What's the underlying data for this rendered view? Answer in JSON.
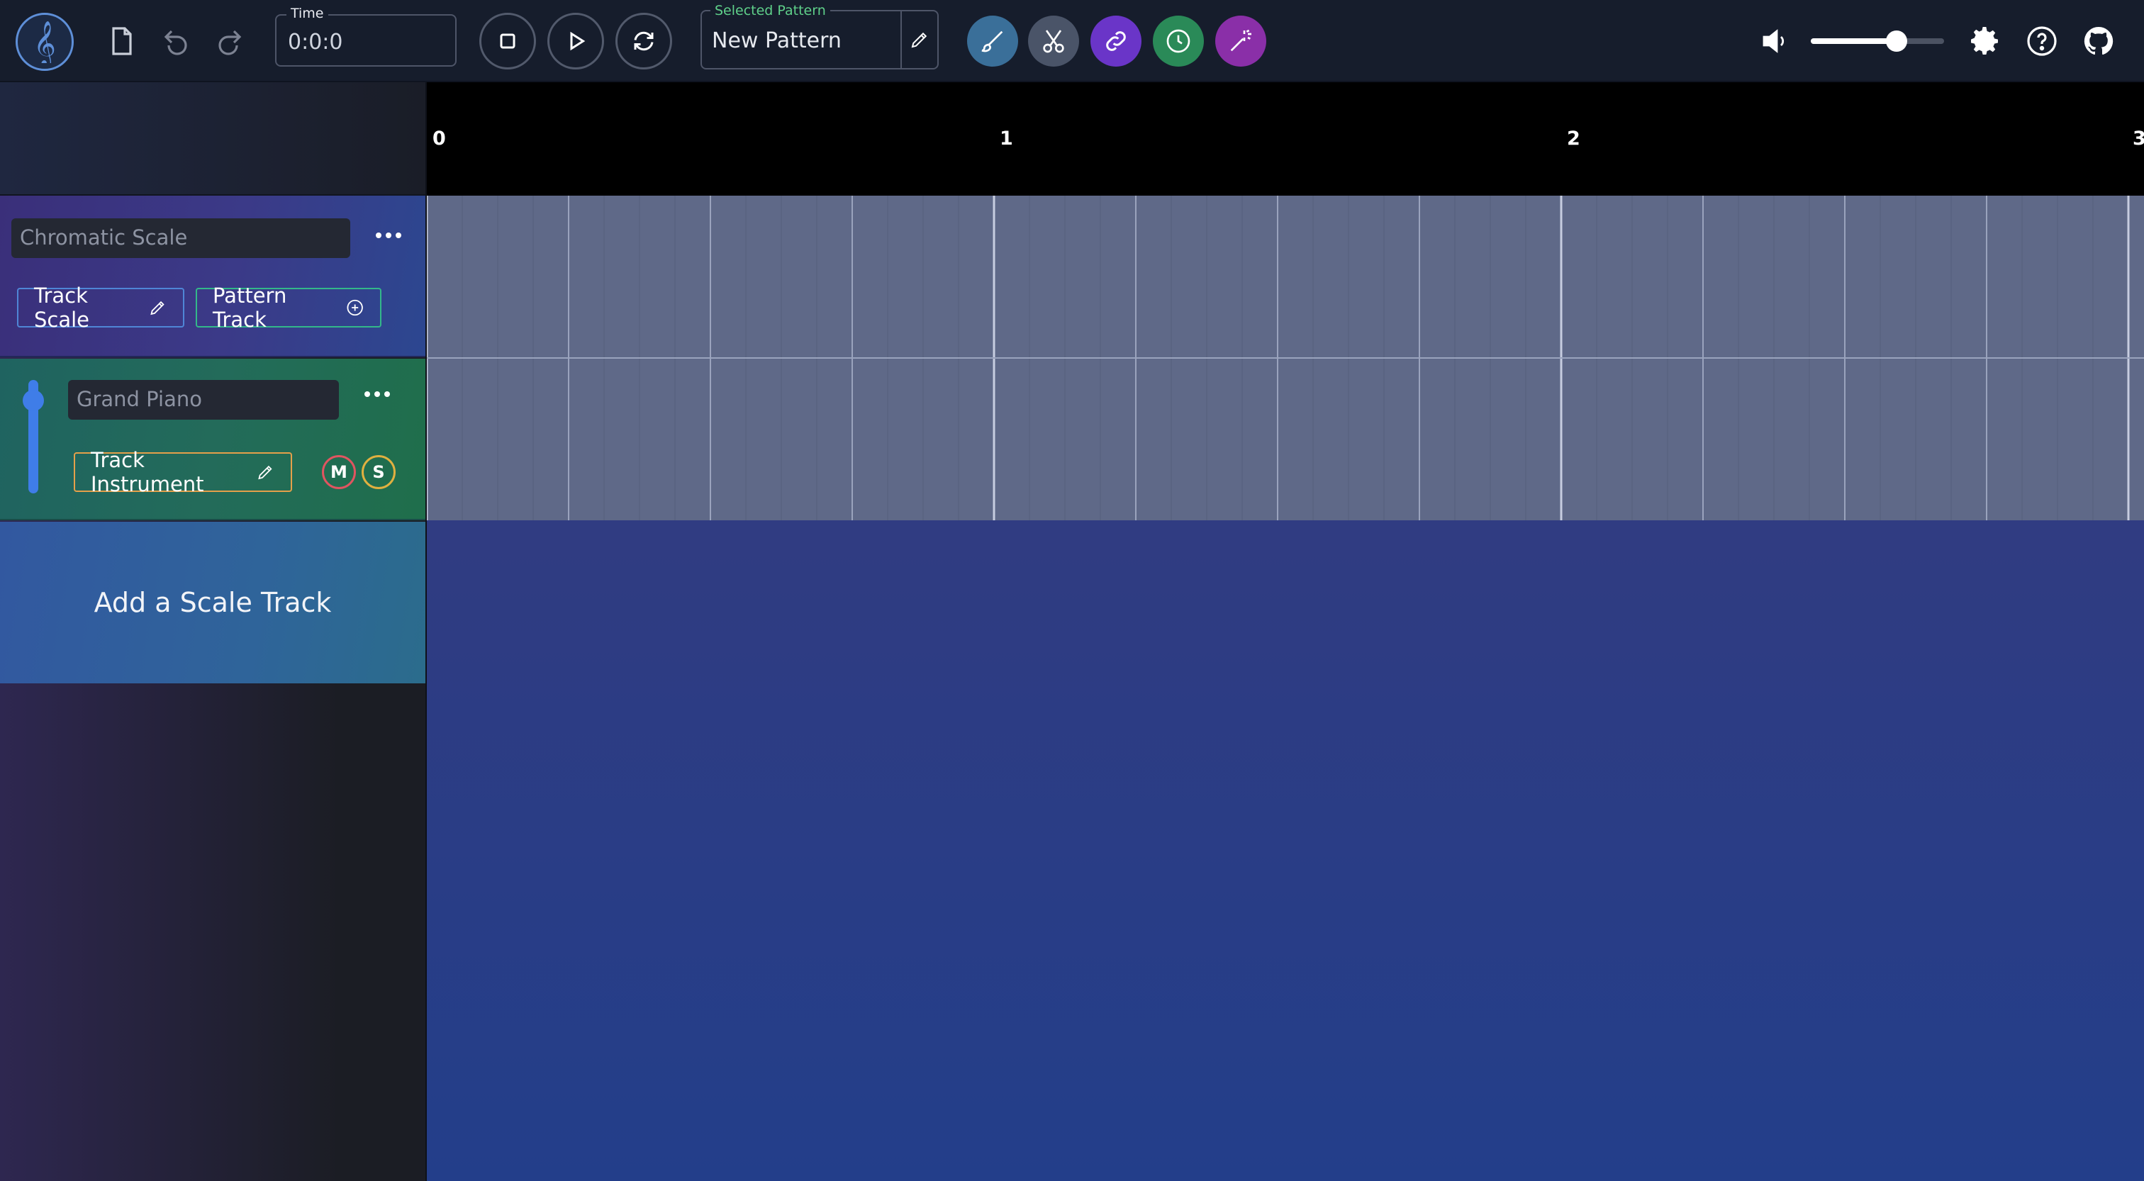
{
  "app": {
    "logo_icon": "treble-clef-icon",
    "brand_color": "#5e8fd8"
  },
  "toolbar": {
    "new_file_icon": "file-icon",
    "undo_icon": "undo-icon",
    "redo_icon": "redo-icon",
    "time": {
      "label": "Time",
      "value": "0:0:0"
    },
    "transport": {
      "stop_icon": "stop-icon",
      "play_icon": "play-icon",
      "loop_icon": "loop-icon"
    },
    "selected_pattern": {
      "label": "Selected Pattern",
      "value": "New Pattern",
      "edit_icon": "pencil-icon"
    },
    "tools": [
      {
        "name": "brush-icon",
        "color": "#3a6f99"
      },
      {
        "name": "scissors-icon",
        "color": "#4a5468"
      },
      {
        "name": "link-icon",
        "color": "#6a35c8"
      },
      {
        "name": "clock-icon",
        "color": "#2a8a58"
      },
      {
        "name": "magic-wand-icon",
        "color": "#8a2fa8"
      }
    ],
    "volume": {
      "icon": "volume-icon",
      "level": 0.64
    },
    "settings_icon": "gear-icon",
    "help_icon": "help-icon",
    "github_icon": "github-icon"
  },
  "tracks": {
    "scale_track": {
      "name_placeholder": "Chromatic Scale",
      "buttons": {
        "track_scale": "Track Scale",
        "pattern_track": "Pattern Track"
      },
      "menu_icon": "more-dots-icon"
    },
    "instrument_track": {
      "name_placeholder": "Grand Piano",
      "buttons": {
        "track_instrument": "Track Instrument",
        "mute": "M",
        "solo": "S"
      },
      "volume_level": 0.9,
      "menu_icon": "more-dots-icon"
    },
    "add_track_label": "Add a Scale Track"
  },
  "timeline": {
    "ruler_labels": [
      "0",
      "1",
      "2",
      "3"
    ],
    "subdivisions_per_bar": 16
  }
}
